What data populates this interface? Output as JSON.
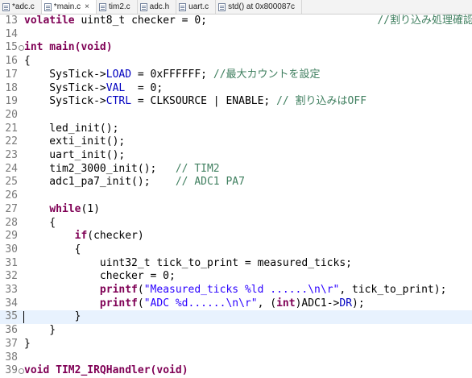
{
  "tabs": [
    {
      "label": "*adc.c",
      "close": "",
      "active": false
    },
    {
      "label": "*main.c",
      "close": "×",
      "active": true
    },
    {
      "label": "tim2.c",
      "close": "",
      "active": false
    },
    {
      "label": "adc.h",
      "close": "",
      "active": false
    },
    {
      "label": "uart.c",
      "close": "",
      "active": false
    },
    {
      "label": "std() at 0x800087c",
      "close": "",
      "active": false
    }
  ],
  "code": {
    "l13": {
      "num": "13",
      "a": "volatile",
      "b": " uint8_t checker = 0;",
      "c": "                           //割り込み処理確認"
    },
    "l14": {
      "num": "14"
    },
    "l15": {
      "num": "15",
      "a": "int",
      "b": " main(",
      "c": "void",
      "d": ")"
    },
    "l16": {
      "num": "16",
      "t": "{"
    },
    "l17": {
      "num": "17",
      "a": "    SysTick->",
      "b": "LOAD",
      "c": " = 0xFFFFFF; ",
      "d": "//最大カウントを設定"
    },
    "l18": {
      "num": "18",
      "a": "    SysTick->",
      "b": "VAL",
      "c": "  = 0;"
    },
    "l19": {
      "num": "19",
      "a": "    SysTick->",
      "b": "CTRL",
      "c": " = CLKSOURCE | ENABLE; ",
      "d": "// 割り込みはOFF"
    },
    "l20": {
      "num": "20"
    },
    "l21": {
      "num": "21",
      "t": "    led_init();"
    },
    "l22": {
      "num": "22",
      "t": "    exti_init();"
    },
    "l23": {
      "num": "23",
      "t": "    uart_init();"
    },
    "l24": {
      "num": "24",
      "a": "    tim2_3000_init();   ",
      "b": "// TIM2"
    },
    "l25": {
      "num": "25",
      "a": "    adc1_pa7_init();    ",
      "b": "// ADC1 PA7"
    },
    "l26": {
      "num": "26"
    },
    "l27": {
      "num": "27",
      "a": "    ",
      "b": "while",
      "c": "(1)"
    },
    "l28": {
      "num": "28",
      "t": "    {"
    },
    "l29": {
      "num": "29",
      "a": "        ",
      "b": "if",
      "c": "(checker)"
    },
    "l30": {
      "num": "30",
      "t": "        {"
    },
    "l31": {
      "num": "31",
      "t": "            uint32_t tick_to_print = measured_ticks;"
    },
    "l32": {
      "num": "32",
      "t": "            checker = 0;"
    },
    "l33": {
      "num": "33",
      "a": "            ",
      "b": "printf",
      "c": "(",
      "d": "\"Measured_ticks %ld ......\\n\\r\"",
      "e": ", tick_to_print);"
    },
    "l34": {
      "num": "34",
      "a": "            ",
      "b": "printf",
      "c": "(",
      "d": "\"ADC %d......\\n\\r\"",
      "e": ", (",
      "f": "int",
      "g": ")ADC1->",
      "h": "DR",
      "i": ");"
    },
    "l35": {
      "num": "35",
      "t": "        }"
    },
    "l36": {
      "num": "36",
      "t": "    }"
    },
    "l37": {
      "num": "37",
      "t": "}"
    },
    "l38": {
      "num": "38"
    },
    "l39": {
      "num": "39",
      "a": "void",
      "b": " TIM2_IRQHandler(",
      "c": "void",
      "d": ")"
    }
  }
}
